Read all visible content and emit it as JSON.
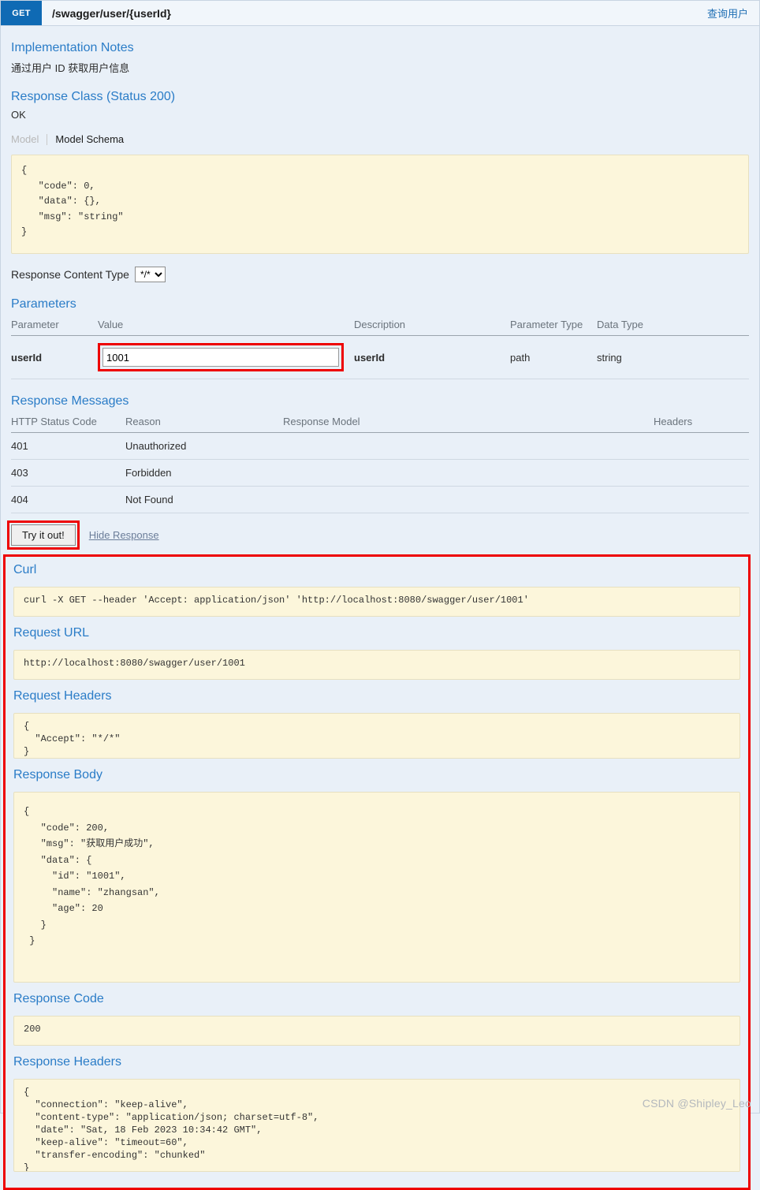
{
  "operation": {
    "method": "GET",
    "path": "/swagger/user/{userId}",
    "summary": "查询用户"
  },
  "sections": {
    "implementation_notes_title": "Implementation Notes",
    "implementation_notes_text": "通过用户 ID 获取用户信息",
    "response_class_title": "Response Class (Status 200)",
    "response_class_text": "OK",
    "parameters_title": "Parameters",
    "response_messages_title": "Response Messages",
    "curl_title": "Curl",
    "request_url_title": "Request URL",
    "request_headers_title": "Request Headers",
    "response_body_title": "Response Body",
    "response_code_title": "Response Code",
    "response_headers_title": "Response Headers"
  },
  "model_tabs": {
    "model": "Model",
    "model_schema": "Model Schema"
  },
  "model_schema_json": "{\n   \"code\": 0,\n   \"data\": {},\n   \"msg\": \"string\"\n}",
  "content_type": {
    "label": "Response Content Type",
    "selected": "*/*",
    "options": [
      "*/*"
    ]
  },
  "parameters_table": {
    "headers": [
      "Parameter",
      "Value",
      "Description",
      "Parameter Type",
      "Data Type"
    ],
    "rows": [
      {
        "parameter": "userId",
        "value": "1001",
        "placeholder": "",
        "description": "userId",
        "parameter_type": "path",
        "data_type": "string"
      }
    ]
  },
  "response_messages_table": {
    "headers": [
      "HTTP Status Code",
      "Reason",
      "Response Model",
      "Headers"
    ],
    "rows": [
      {
        "code": "401",
        "reason": "Unauthorized",
        "model": "",
        "headers": ""
      },
      {
        "code": "403",
        "reason": "Forbidden",
        "model": "",
        "headers": ""
      },
      {
        "code": "404",
        "reason": "Not Found",
        "model": "",
        "headers": ""
      }
    ]
  },
  "actions": {
    "try_it_out": "Try it out!",
    "hide_response": "Hide Response"
  },
  "result": {
    "curl": "curl -X GET --header 'Accept: application/json' 'http://localhost:8080/swagger/user/1001'",
    "request_url": "http://localhost:8080/swagger/user/1001",
    "request_headers": "{\n  \"Accept\": \"*/*\"\n}",
    "response_body": "{\n   \"code\": 200,\n   \"msg\": \"获取用户成功\",\n   \"data\": {\n     \"id\": \"1001\",\n     \"name\": \"zhangsan\",\n     \"age\": 20\n   }\n }",
    "response_code": "200",
    "response_headers": "{\n  \"connection\": \"keep-alive\",\n  \"content-type\": \"application/json; charset=utf-8\",\n  \"date\": \"Sat, 18 Feb 2023 10:34:42 GMT\",\n  \"keep-alive\": \"timeout=60\",\n  \"transfer-encoding\": \"chunked\"\n}"
  },
  "watermark": "CSDN @Shipley_Leo",
  "colors": {
    "method_badge": "#0f6ab4",
    "accent_link": "#2a7cc7",
    "page_background": "#e9f0f8",
    "snippet_background": "#fcf6db",
    "annotation_red": "#ee0000"
  }
}
